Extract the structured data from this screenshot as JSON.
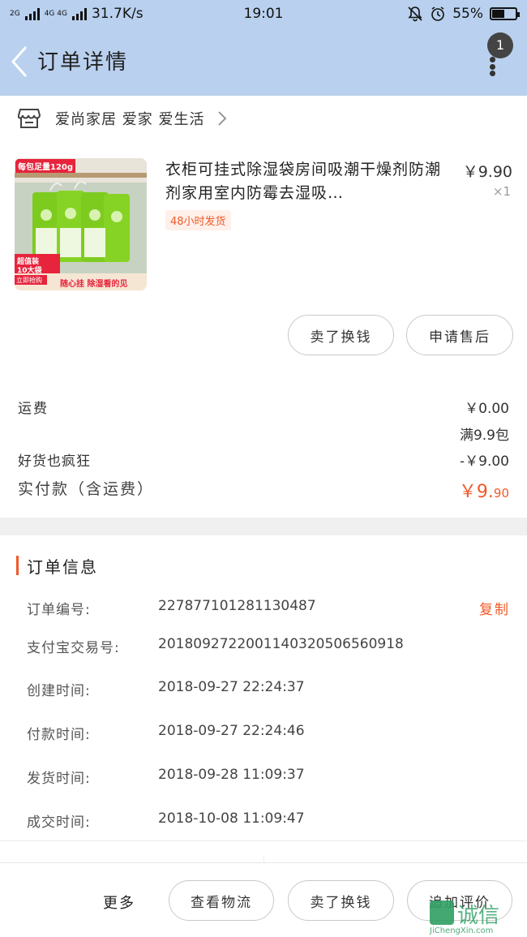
{
  "status_bar": {
    "network_left": "2G",
    "network_right": "4G 4G",
    "speed": "31.7K/s",
    "time": "19:01",
    "battery_percent_text": "55%",
    "battery_level": 0.55
  },
  "nav": {
    "title": "订单详情",
    "badge_count": "1"
  },
  "shop": {
    "name": "爱尚家居 爱家 爱生活"
  },
  "product": {
    "title": "衣柜可挂式除湿袋房间吸潮干燥剂防潮剂家用室内防霉去湿吸…",
    "price": "￥9.90",
    "quantity": "×1",
    "tag": "48小时发货",
    "thumb_text": {
      "top": "每包足量120g",
      "badge_line1": "超值装",
      "badge_line2": "10大袋",
      "promo_small": "立即抢购",
      "bottom": "随心挂 除湿看的见"
    }
  },
  "actions": {
    "sell": "卖了换钱",
    "after_sale": "申请售后"
  },
  "fees": {
    "shipping_label": "运费",
    "shipping_value": "￥0.00",
    "shipping_note": "满9.9包",
    "discount_label": "好货也疯狂",
    "discount_value": "-￥9.00",
    "paid_label": "实付款（含运费）",
    "paid_value_int": "￥9.",
    "paid_value_dec": "90"
  },
  "order_info": {
    "title": "订单信息",
    "copy_label": "复制",
    "rows": [
      {
        "label": "订单编号:",
        "value": "227877101281130487"
      },
      {
        "label": "支付宝交易号:",
        "value": "2018092722001140320506560918"
      },
      {
        "label": "创建时间:",
        "value": "2018-09-27 22:24:37"
      },
      {
        "label": "付款时间:",
        "value": "2018-09-27 22:24:46"
      },
      {
        "label": "发货时间:",
        "value": "2018-09-28 11:09:37"
      },
      {
        "label": "成交时间:",
        "value": "2018-10-08 11:09:47"
      }
    ]
  },
  "bottom_bar": {
    "more": "更多",
    "logistics": "查看物流",
    "sell": "卖了换钱",
    "add_review": "追加评价"
  },
  "watermark": {
    "text": "诚信",
    "domain": "JiChengXin.com"
  },
  "colors": {
    "header_bg": "#b9d0ee",
    "accent": "#f05a28"
  }
}
